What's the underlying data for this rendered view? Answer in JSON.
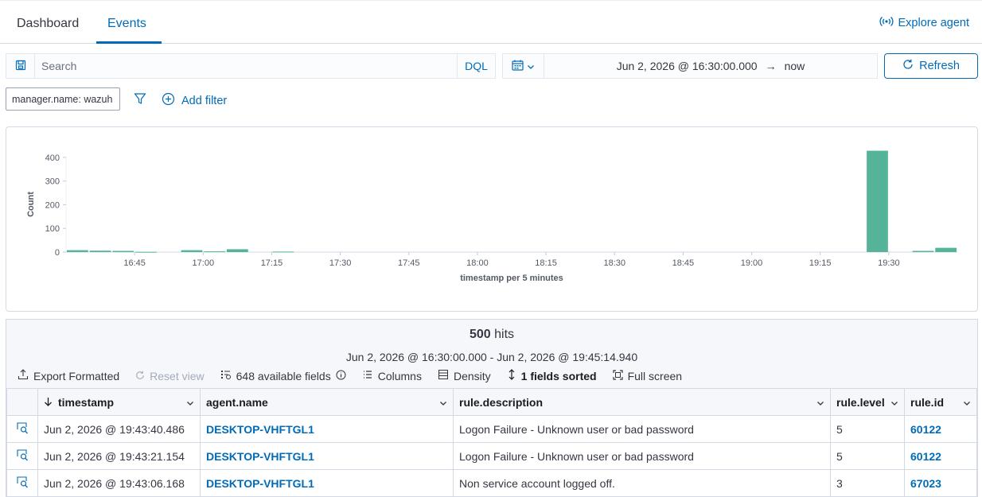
{
  "tabs": [
    {
      "label": "Dashboard"
    },
    {
      "label": "Events"
    }
  ],
  "explore_agent_label": "Explore agent",
  "search": {
    "placeholder": "Search",
    "language": "DQL"
  },
  "date_range": {
    "start": "Jun 2, 2026 @ 16:30:00.000",
    "arrow": "→",
    "end": "now"
  },
  "refresh_label": "Refresh",
  "filters": [
    {
      "label": "manager.name: wazuh"
    }
  ],
  "add_filter_label": "Add filter",
  "chart_data": {
    "type": "bar",
    "xlabel": "timestamp per 5 minutes",
    "ylabel": "Count",
    "ylim": [
      0,
      450
    ],
    "y_ticks": [
      0,
      100,
      200,
      300,
      400
    ],
    "x_ticks": [
      "16:45",
      "17:00",
      "17:15",
      "17:30",
      "17:45",
      "18:00",
      "18:15",
      "18:30",
      "18:45",
      "19:00",
      "19:15",
      "19:30"
    ],
    "x_range_minutes": [
      16.5,
      19.75
    ],
    "bar_color": "#54b399",
    "bars": [
      {
        "start": "16:30",
        "value": 8
      },
      {
        "start": "16:35",
        "value": 6
      },
      {
        "start": "16:40",
        "value": 5
      },
      {
        "start": "16:45",
        "value": 1
      },
      {
        "start": "16:55",
        "value": 8
      },
      {
        "start": "17:00",
        "value": 3
      },
      {
        "start": "17:05",
        "value": 12
      },
      {
        "start": "17:15",
        "value": 2
      },
      {
        "start": "19:25",
        "value": 428
      },
      {
        "start": "19:35",
        "value": 5
      },
      {
        "start": "19:40",
        "value": 18
      }
    ]
  },
  "results": {
    "hits_count": "500",
    "hits_label": " hits",
    "range": "Jun 2, 2026 @ 16:30:00.000 - Jun 2, 2026 @ 19:45:14.940",
    "toolbar": {
      "export": "Export Formatted",
      "reset": "Reset view",
      "fields": "648 available fields",
      "columns": "Columns",
      "density": "Density",
      "sorted": "1 fields sorted",
      "fullscreen": "Full screen"
    },
    "columns": [
      "timestamp",
      "agent.name",
      "rule.description",
      "rule.level",
      "rule.id"
    ],
    "rows": [
      {
        "timestamp": "Jun 2, 2026 @ 19:43:40.486",
        "agent": "DESKTOP-VHFTGL1",
        "description": "Logon Failure - Unknown user or bad password",
        "level": "5",
        "id": "60122"
      },
      {
        "timestamp": "Jun 2, 2026 @ 19:43:21.154",
        "agent": "DESKTOP-VHFTGL1",
        "description": "Logon Failure - Unknown user or bad password",
        "level": "5",
        "id": "60122"
      },
      {
        "timestamp": "Jun 2, 2026 @ 19:43:06.168",
        "agent": "DESKTOP-VHFTGL1",
        "description": "Non service account logged off.",
        "level": "3",
        "id": "67023"
      }
    ]
  }
}
